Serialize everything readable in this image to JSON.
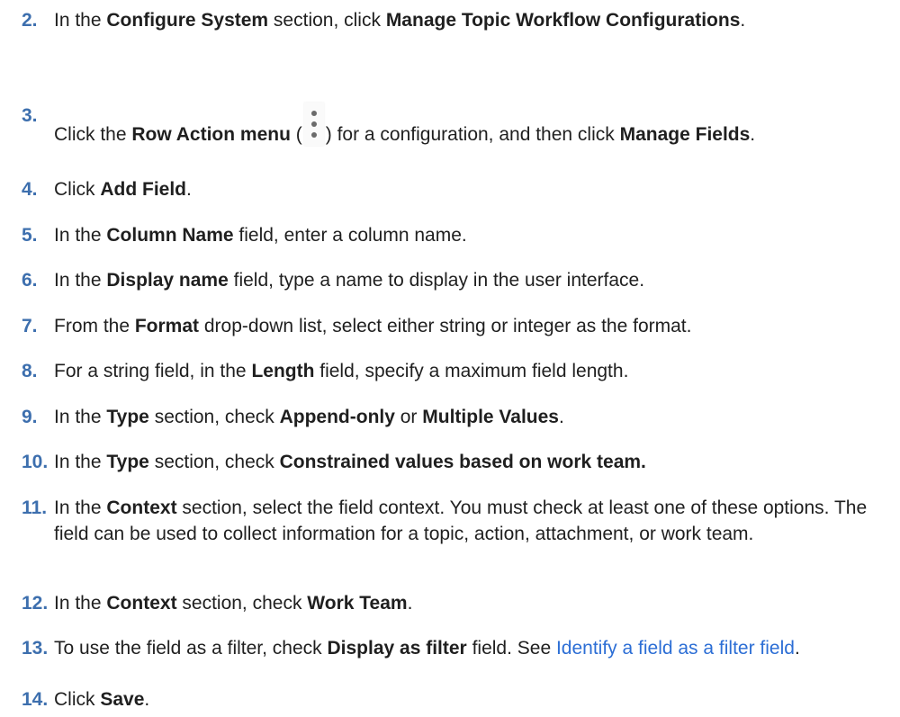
{
  "steps": [
    {
      "num": "2.",
      "p0": "In the ",
      "b0": "Configure System",
      "p1": " section, click ",
      "b1": "Manage Topic Workflow Configurations",
      "p2": "."
    },
    {
      "num": "3.",
      "p0": "Click the ",
      "b0": "Row Action menu",
      "p1": " (",
      "icon": "kebab-menu-icon",
      "p2": ") for a configuration, and then click ",
      "b1": "Manage Fields",
      "p3": "."
    },
    {
      "num": "4.",
      "p0": "Click ",
      "b0": "Add Field",
      "p1": "."
    },
    {
      "num": "5.",
      "p0": "In the ",
      "b0": "Column Name",
      "p1": " field, enter a column name."
    },
    {
      "num": "6.",
      "p0": "In the ",
      "b0": "Display name",
      "p1": " field, type a name to display in the user interface."
    },
    {
      "num": "7.",
      "p0": "From the ",
      "b0": "Format",
      "p1": " drop-down list, select either string or integer as the format."
    },
    {
      "num": "8.",
      "p0": "For a string field, in the ",
      "b0": "Length",
      "p1": " field, specify a maximum field length."
    },
    {
      "num": "9.",
      "p0": "In the ",
      "b0": "Type",
      "p1": " section, check ",
      "b1": "Append-only",
      "p2": " or ",
      "b2": "Multiple Values",
      "p3": "."
    },
    {
      "num": "10.",
      "p0": "In the ",
      "b0": "Type",
      "p1": " section, check ",
      "b1": "Constrained values based on work team."
    },
    {
      "num": "11.",
      "p0": "In the ",
      "b0": "Context",
      "p1": " section, select the field context. You must check at least one of these options. The field can be used to collect information for a topic, action, attachment, or work team."
    },
    {
      "num": "12.",
      "p0": "In the ",
      "b0": "Context",
      "p1": " section, check ",
      "b1": "Work Team",
      "p2": "."
    },
    {
      "num": "13.",
      "p0": "To use the field as a filter, check ",
      "b0": "Display as filter",
      "p1": " field. See ",
      "link": "Identify a field as a filter field",
      "p2": "."
    },
    {
      "num": "14.",
      "p0": "Click ",
      "b0": "Save",
      "p1": "."
    }
  ],
  "colors": {
    "step_number": "#3d6fae",
    "link": "#2c6ed5",
    "text": "#1f1f1f"
  }
}
